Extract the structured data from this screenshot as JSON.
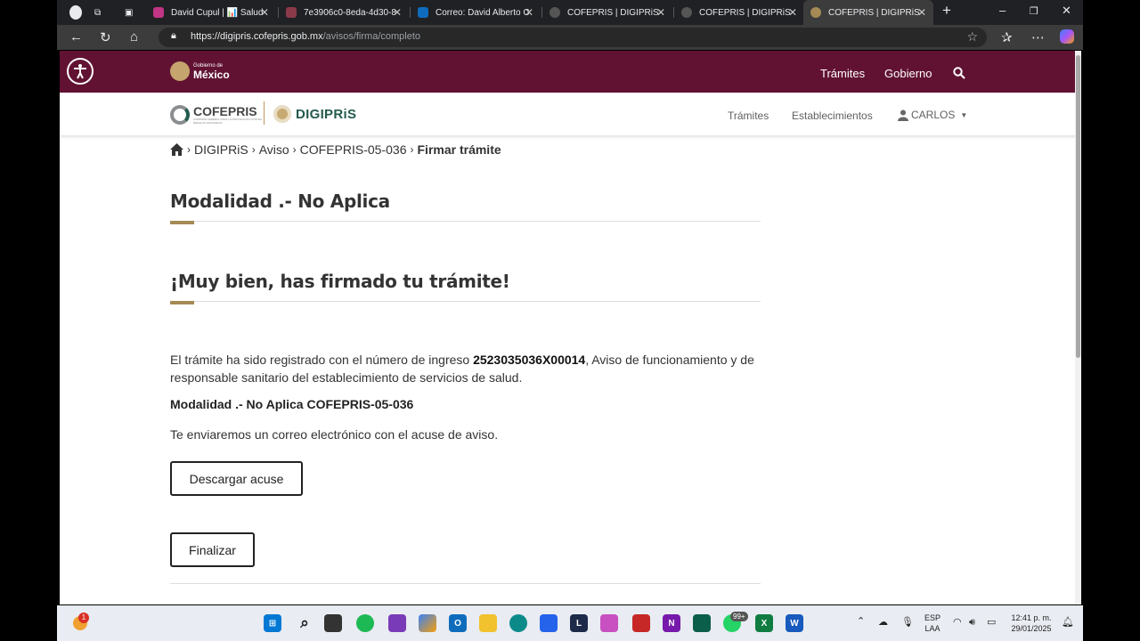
{
  "browser": {
    "tabs": [
      {
        "title": "David Cupul | 📊 Salud",
        "favicon_color": "#c13584"
      },
      {
        "title": "7e3906c0-8eda-4d30-8",
        "favicon_color": "#8b3a4a"
      },
      {
        "title": "Correo: David Alberto C",
        "favicon_color": "#0f6cbd"
      },
      {
        "title": "COFEPRIS | DIGIPRiS",
        "favicon_color": "#555555"
      },
      {
        "title": "COFEPRIS | DIGIPRiS",
        "favicon_color": "#555555"
      },
      {
        "title": "COFEPRIS | DIGIPRiS",
        "favicon_color": "#a58a56"
      }
    ],
    "url_host": "https://digipris.cofepris.gob.mx",
    "url_path": "/avisos/firma/completo"
  },
  "gob_header": {
    "logo_small": "Gobierno de",
    "logo_big": "México",
    "nav": [
      "Trámites",
      "Gobierno"
    ]
  },
  "site_header": {
    "brand1": "COFEPRIS",
    "brand1_sub": "COMISIÓN FEDERAL PARA LA PROTECCIÓN CONTRA RIESGOS SANITARIOS",
    "brand2": "DIGIPRiS",
    "nav": [
      "Trámites",
      "Establecimientos"
    ],
    "user": "CARLOS"
  },
  "breadcrumb": {
    "items": [
      "DIGIPRiS",
      "Aviso",
      "COFEPRIS-05-036"
    ],
    "current": "Firmar trámite"
  },
  "main": {
    "modality_title": "Modalidad .- No Aplica",
    "success_title": "¡Muy bien, has firmado tu trámite!",
    "registered_text_a": "El trámite ha sido registrado con el número de ingreso ",
    "registration_number": "2523035036X00014",
    "registered_text_b": ", Aviso de funcionamiento y de responsable sanitario del establecimiento de servicios de salud.",
    "modality_line": "Modalidad .- No Aplica COFEPRIS-05-036",
    "email_notice": "Te enviaremos un correo electrónico con el acuse de aviso.",
    "download_button": "Descargar acuse",
    "finish_button": "Finalizar"
  },
  "taskbar": {
    "notification_badge": "1",
    "whatsapp_badge": "99+",
    "language": "ESP",
    "layout": "LAA",
    "time": "12:41 p. m.",
    "date": "29/01/2025"
  },
  "colors": {
    "gob_bar": "#611232",
    "accent_gold": "#a58a56",
    "digipris_green": "#235b4e"
  }
}
